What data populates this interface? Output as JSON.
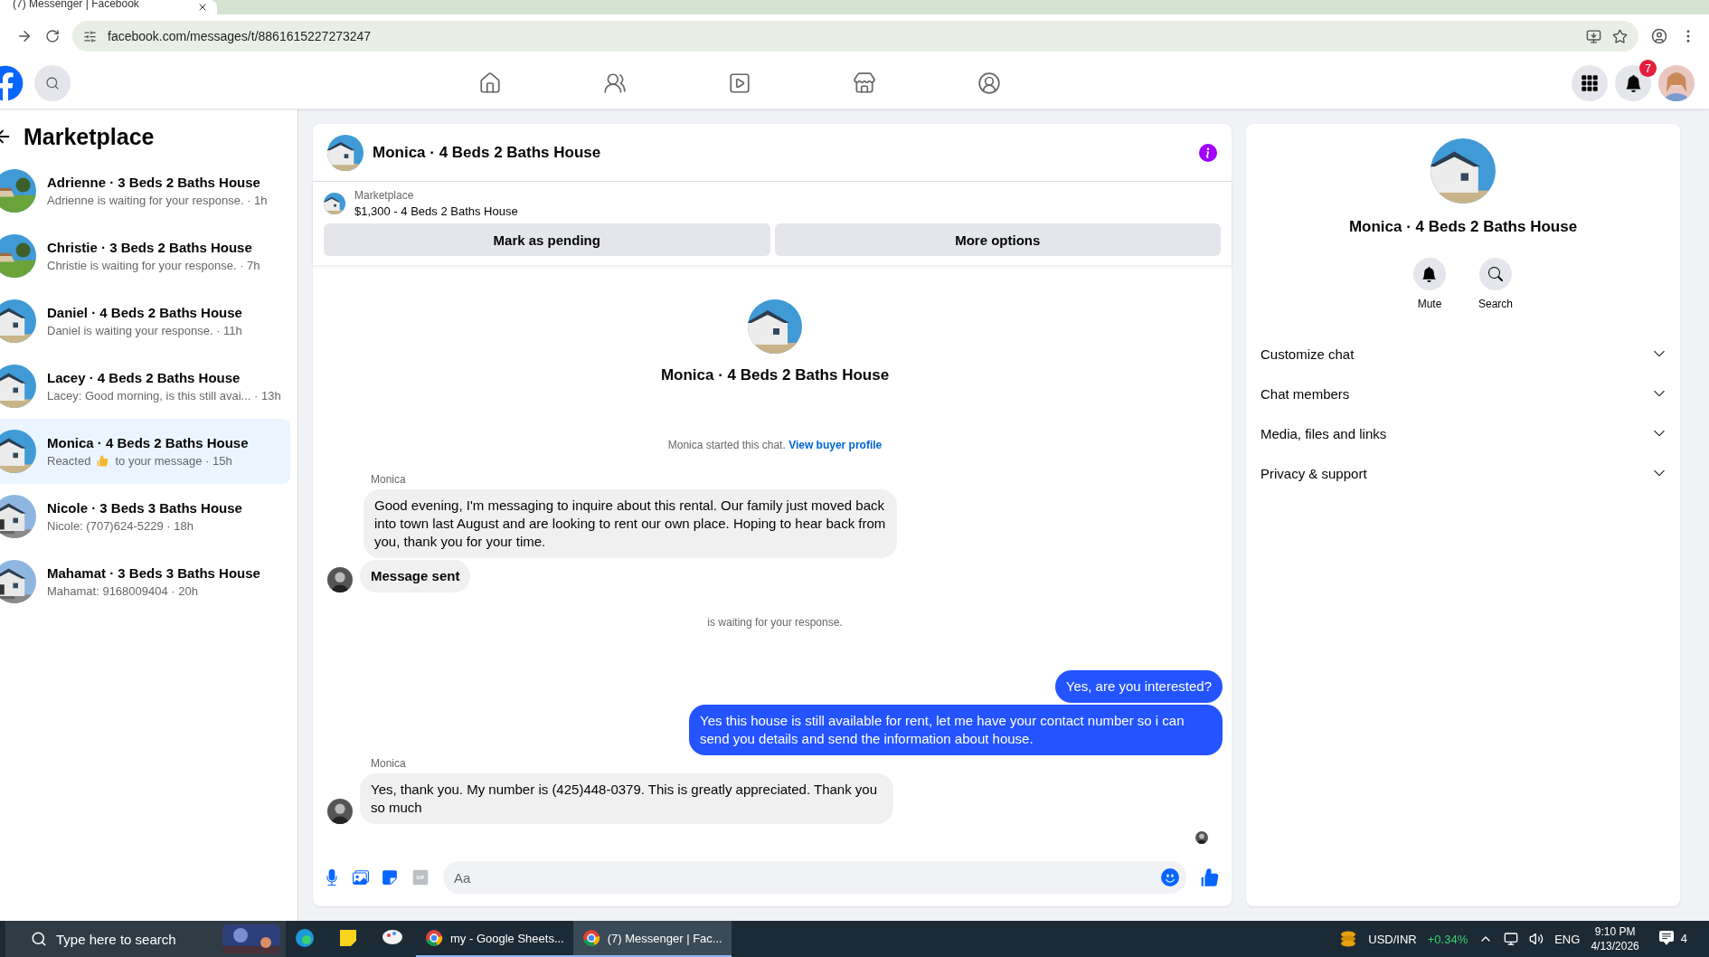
{
  "browser": {
    "tab_title": "(7) Messenger | Facebook",
    "url": "facebook.com/messages/t/8861615227273247"
  },
  "header": {
    "notification_count": "7"
  },
  "sidebar": {
    "title": "Marketplace",
    "conversations": [
      {
        "title": "Adrienne · 3 Beds 2 Baths House",
        "preview": "Adrienne is waiting for your response. · 1h",
        "kind": "lawn",
        "selected": false
      },
      {
        "title": "Christie · 3 Beds 2 Baths House",
        "preview": "Christie is waiting for your response. · 7h",
        "kind": "lawn",
        "selected": false
      },
      {
        "title": "Daniel · 4 Beds 2 Baths House",
        "preview": "Daniel is waiting your response. · 11h",
        "kind": "modern",
        "selected": false
      },
      {
        "title": "Lacey · 4 Beds 2 Baths House",
        "preview": "Lacey: Good morning, is this still avai... · 13h",
        "kind": "modern",
        "selected": false
      },
      {
        "title": "Monica · 4 Beds 2 Baths House",
        "preview": "Reacted",
        "preview_after": "to your message · 15h",
        "kind": "modern",
        "selected": true
      },
      {
        "title": "Nicole · 3 Beds 3 Baths House",
        "preview": "Nicole: (707)624-5229 · 18h",
        "kind": "porch",
        "selected": false
      },
      {
        "title": "Mahamat · 3 Beds 3 Baths House",
        "preview": "Mahamat: 9168009404 · 20h",
        "kind": "porch",
        "selected": false
      }
    ]
  },
  "chat": {
    "title": "Monica · 4 Beds 2 Baths House",
    "listing": {
      "source": "Marketplace",
      "summary": "$1,300 - 4 Beds 2 Baths House"
    },
    "actions": [
      "Mark as pending",
      "More options"
    ],
    "intro": {
      "title": "Monica · 4 Beds 2 Baths House",
      "started": "Monica started this chat.",
      "link": "View buyer profile"
    },
    "messages": [
      {
        "kind": "sender",
        "text": "Monica"
      },
      {
        "kind": "incoming",
        "text": "Good evening, I'm messaging to inquire about this rental. Our family just moved back into town last August and are looking to rent our own place. Hoping to hear back from you, thank you for your time.",
        "avatar": false,
        "strong": false
      },
      {
        "kind": "incoming",
        "text": "Message sent",
        "avatar": true,
        "strong": true
      },
      {
        "kind": "system",
        "text": "is waiting for your response."
      },
      {
        "kind": "outgoing",
        "text": "Yes, are you interested?"
      },
      {
        "kind": "outgoing",
        "text": "Yes this house is still available for rent, let me have your contact number so i can send you details and send the information about house."
      },
      {
        "kind": "sender",
        "text": "Monica"
      },
      {
        "kind": "incoming",
        "text": "Yes, thank you. My number is (425)448-0379. This is greatly appreciated. Thank you so much",
        "avatar": true,
        "strong": false
      },
      {
        "kind": "seen"
      }
    ],
    "composer": {
      "placeholder": "Aa"
    }
  },
  "details": {
    "title": "Monica · 4 Beds 2 Baths House",
    "actions": [
      {
        "label": "Mute",
        "kind": "mute"
      },
      {
        "label": "Search",
        "kind": "search"
      }
    ],
    "sections": [
      "Customize chat",
      "Chat members",
      "Media, files and links",
      "Privacy & support"
    ]
  },
  "taskbar": {
    "search_placeholder": "Type here to search",
    "apps": [
      {
        "kind": "edge"
      },
      {
        "kind": "notes"
      },
      {
        "kind": "paint"
      },
      {
        "kind": "chrome",
        "label": "my - Google Sheets...",
        "selected": false
      },
      {
        "kind": "chrome",
        "label": "(7) Messenger | Fac...",
        "selected": true
      }
    ],
    "ticker": {
      "label": "USD/INR",
      "change": "+0.34%"
    },
    "language": "ENG",
    "time": "9:10 PM",
    "date": "4/13/2026",
    "notifications": "4"
  }
}
